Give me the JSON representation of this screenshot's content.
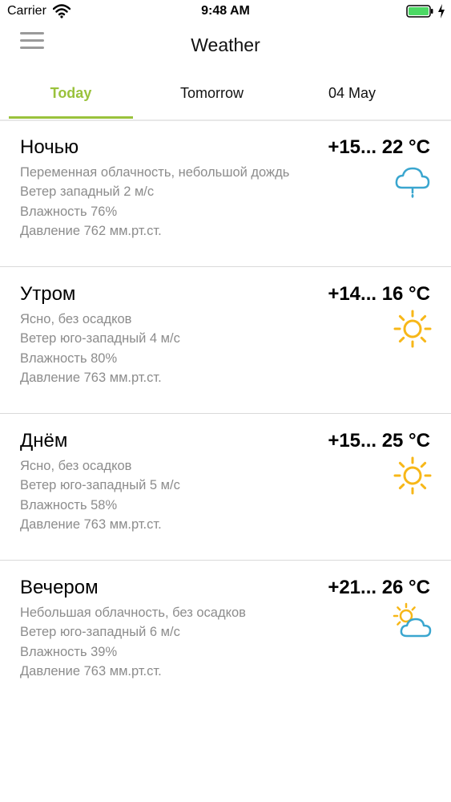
{
  "status_bar": {
    "carrier": "Carrier",
    "time": "9:48 AM"
  },
  "nav": {
    "title": "Weather"
  },
  "tabs": [
    {
      "label": "Today",
      "active": true
    },
    {
      "label": "Tomorrow",
      "active": false
    },
    {
      "label": "04 May",
      "active": false
    }
  ],
  "colors": {
    "accent": "#9ac23c",
    "secondary_text": "#8c8c8c",
    "rain_icon": "#3aa6cf",
    "sun_icon": "#f7b718"
  },
  "forecast": [
    {
      "period": "Ночью",
      "temp": "+15... 22 °C",
      "condition": "Переменная облачность, небольшой дождь",
      "wind": "Ветер западный 2 м/с",
      "humidity": "Влажность 76%",
      "pressure": "Давление 762 мм.рт.ст.",
      "icon": "rain-cloud-icon"
    },
    {
      "period": "Утром",
      "temp": "+14... 16 °C",
      "condition": "Ясно, без осадков",
      "wind": "Ветер юго-западный 4 м/с",
      "humidity": "Влажность 80%",
      "pressure": "Давление 763 мм.рт.ст.",
      "icon": "sun-icon"
    },
    {
      "period": "Днём",
      "temp": "+15... 25 °C",
      "condition": "Ясно, без осадков",
      "wind": "Ветер юго-западный 5 м/с",
      "humidity": "Влажность 58%",
      "pressure": "Давление 763 мм.рт.ст.",
      "icon": "sun-icon"
    },
    {
      "period": "Вечером",
      "temp": "+21... 26 °C",
      "condition": "Небольшая облачность, без осадков",
      "wind": "Ветер юго-западный 6 м/с",
      "humidity": "Влажность 39%",
      "pressure": "Давление 763 мм.рт.ст.",
      "icon": "partly-cloudy-icon"
    }
  ]
}
